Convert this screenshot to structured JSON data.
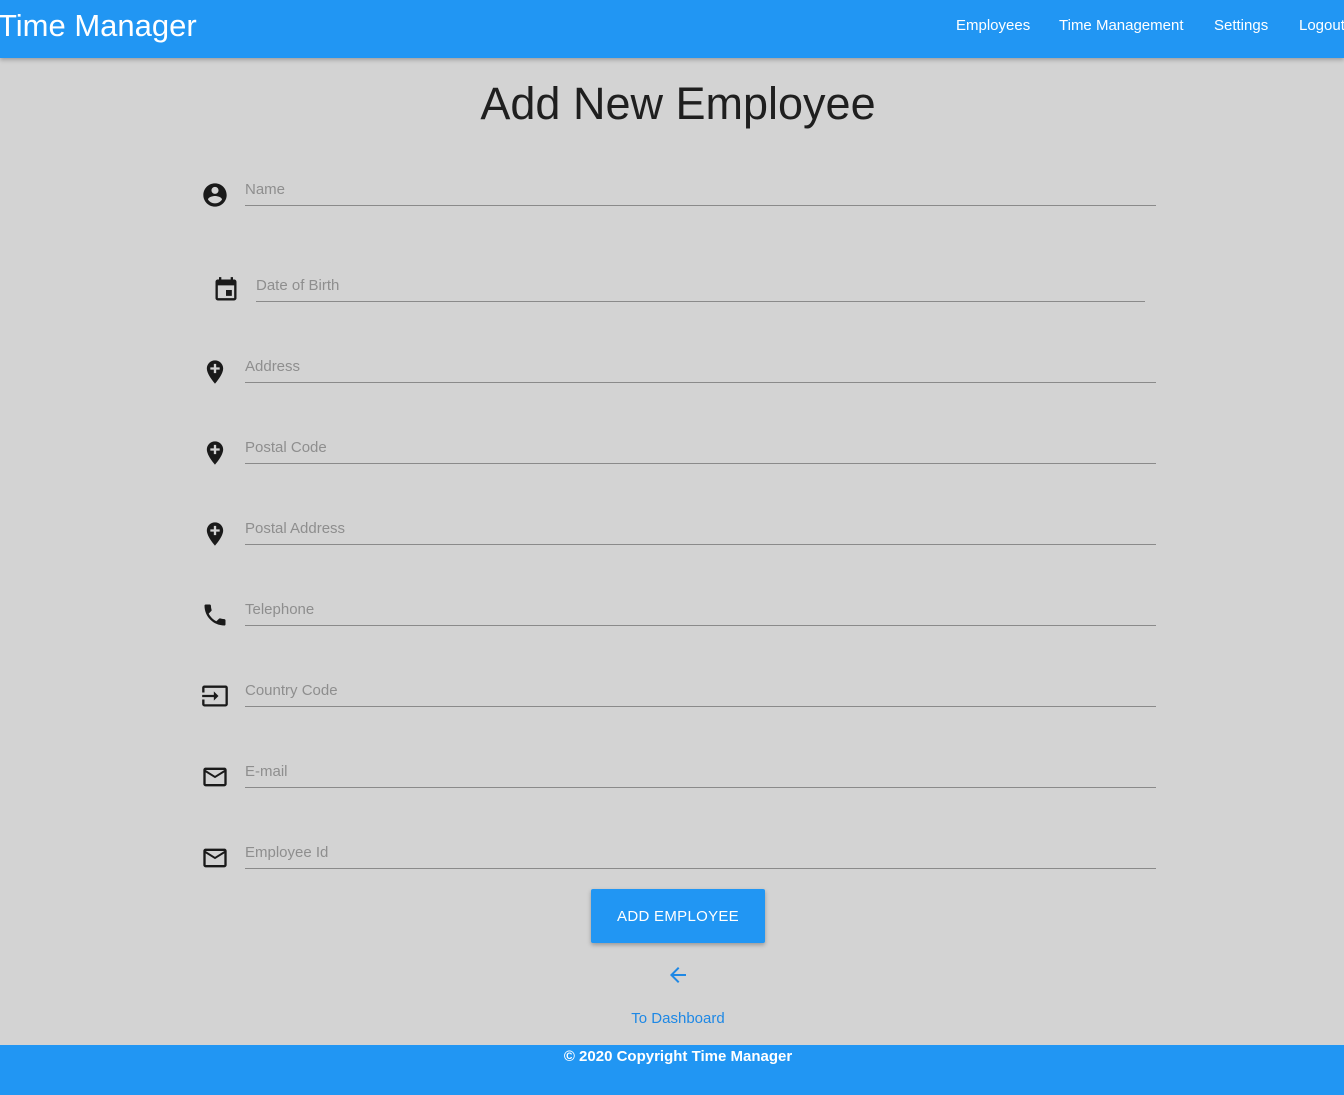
{
  "navbar": {
    "brand": "Time Manager",
    "links": [
      {
        "label": "Employees"
      },
      {
        "label": "Time Management"
      },
      {
        "label": "Settings"
      },
      {
        "label": "Logout"
      }
    ]
  },
  "page": {
    "title": "Add New Employee"
  },
  "form": {
    "fields": [
      {
        "placeholder": "Name",
        "value": "",
        "icon": "account-circle-icon"
      },
      {
        "placeholder": "Date of Birth",
        "value": "",
        "icon": "calendar-icon"
      },
      {
        "placeholder": "Address",
        "value": "",
        "icon": "add-location-icon"
      },
      {
        "placeholder": "Postal Code",
        "value": "",
        "icon": "add-location-icon"
      },
      {
        "placeholder": "Postal Address",
        "value": "",
        "icon": "add-location-icon"
      },
      {
        "placeholder": "Telephone",
        "value": "",
        "icon": "phone-icon"
      },
      {
        "placeholder": "Country Code",
        "value": "",
        "icon": "input-icon"
      },
      {
        "placeholder": "E-mail",
        "value": "",
        "icon": "mail-icon"
      },
      {
        "placeholder": "Employee Id",
        "value": "",
        "icon": "mail-icon"
      }
    ],
    "submit_label": "ADD EMPLOYEE"
  },
  "back": {
    "icon": "arrow-back-icon",
    "label": "To Dashboard"
  },
  "footer": {
    "text": "© 2020 Copyright Time Manager"
  },
  "colors": {
    "primary": "#2196f3",
    "background": "#d3d3d3",
    "link": "#1e88e5"
  }
}
